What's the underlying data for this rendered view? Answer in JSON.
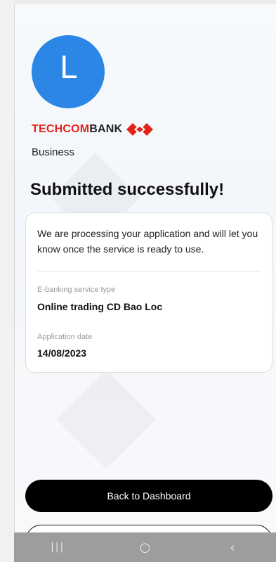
{
  "avatar": {
    "initial": "L",
    "color": "#2b86e5"
  },
  "brand": {
    "name_part1": "TECHCOM",
    "name_part2": "BANK",
    "sub": "Business",
    "accent_color": "#e2231a",
    "logo_icon": "techcombank-diamond-logo"
  },
  "page": {
    "title": "Submitted successfully!"
  },
  "card": {
    "message": "We are processing your application and will let you know once the service is ready to use.",
    "fields": [
      {
        "label": "E-banking service type",
        "value": "Online trading CD Bao Loc"
      },
      {
        "label": "Application date",
        "value": "14/08/2023"
      }
    ]
  },
  "actions": {
    "primary_label": "Back to Dashboard"
  },
  "system_nav": {
    "recent_icon": "recent-apps-icon",
    "home_icon": "home-icon",
    "back_icon": "back-icon",
    "recent_glyph": "|||",
    "home_glyph": "○",
    "back_glyph": "‹"
  }
}
